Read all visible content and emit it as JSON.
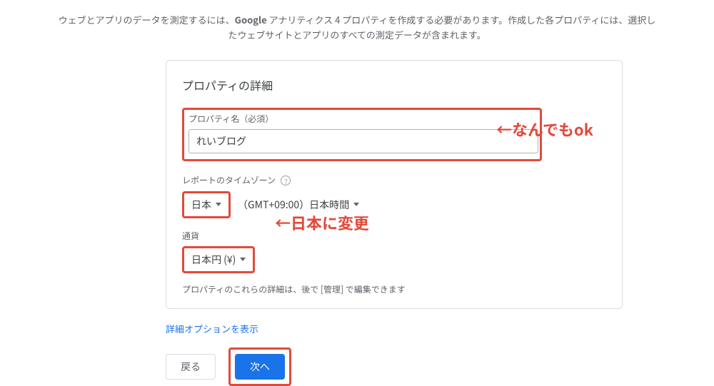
{
  "intro": {
    "line1_pre": "ウェブとアプリのデータを測定するには、",
    "line1_bold": "Google",
    "line1_post": " アナリティクス 4 プロパティを作成する必要があります。作成した各プロパティには、選択したウェブサイトとアプリのすべての測定データが含まれます。"
  },
  "card": {
    "title": "プロパティの詳細",
    "property_name": {
      "label": "プロパティ名（必須）",
      "value": "れいブログ"
    },
    "timezone": {
      "label": "レポートのタイムゾーン",
      "country": "日本",
      "offset_label": "（GMT+09:00）日本時間"
    },
    "currency": {
      "label": "通貨",
      "value": "日本円 (¥)"
    },
    "hint": "プロパティのこれらの詳細は、後で [管理] で編集できます"
  },
  "adv_options_link": "詳細オプションを表示",
  "buttons": {
    "back": "戻る",
    "next": "次へ"
  },
  "annotations": {
    "anything_ok": "←なんでもok",
    "change_to_japan": "←日本に変更"
  }
}
